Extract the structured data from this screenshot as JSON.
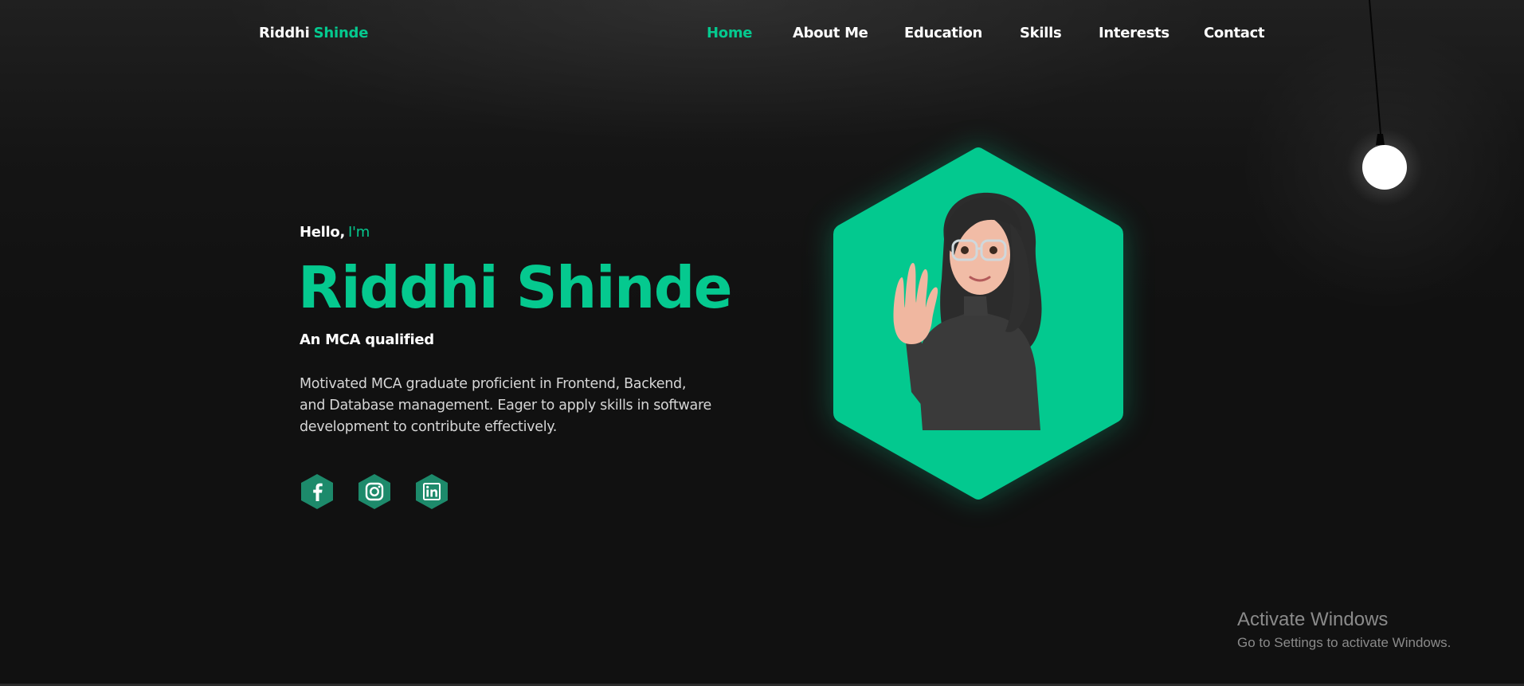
{
  "logo": {
    "first": "Riddhi",
    "last": "Shinde"
  },
  "nav": {
    "items": [
      {
        "label": "Home",
        "active": true
      },
      {
        "label": "About Me",
        "active": false
      },
      {
        "label": "Education",
        "active": false
      },
      {
        "label": "Skills",
        "active": false
      },
      {
        "label": "Interests",
        "active": false
      },
      {
        "label": "Contact",
        "active": false
      }
    ]
  },
  "hero": {
    "greeting": "Hello,",
    "greeting_accent": "I'm",
    "name": "Riddhi Shinde",
    "subtitle": "An MCA qualified",
    "description": "Motivated MCA graduate proficient in Frontend, Backend, and Database management. Eager to apply skills in software development to contribute effectively."
  },
  "social": [
    {
      "icon": "facebook-icon"
    },
    {
      "icon": "instagram-icon"
    },
    {
      "icon": "linkedin-icon"
    }
  ],
  "avatar": {
    "icon": "waving-avatar-illustration"
  },
  "watermark": {
    "title": "Activate Windows",
    "subtitle": "Go to Settings to activate Windows."
  },
  "colors": {
    "accent": "#05c98f",
    "background": "#111111",
    "social_bg": "#1d8a6b",
    "text": "#ffffff"
  }
}
